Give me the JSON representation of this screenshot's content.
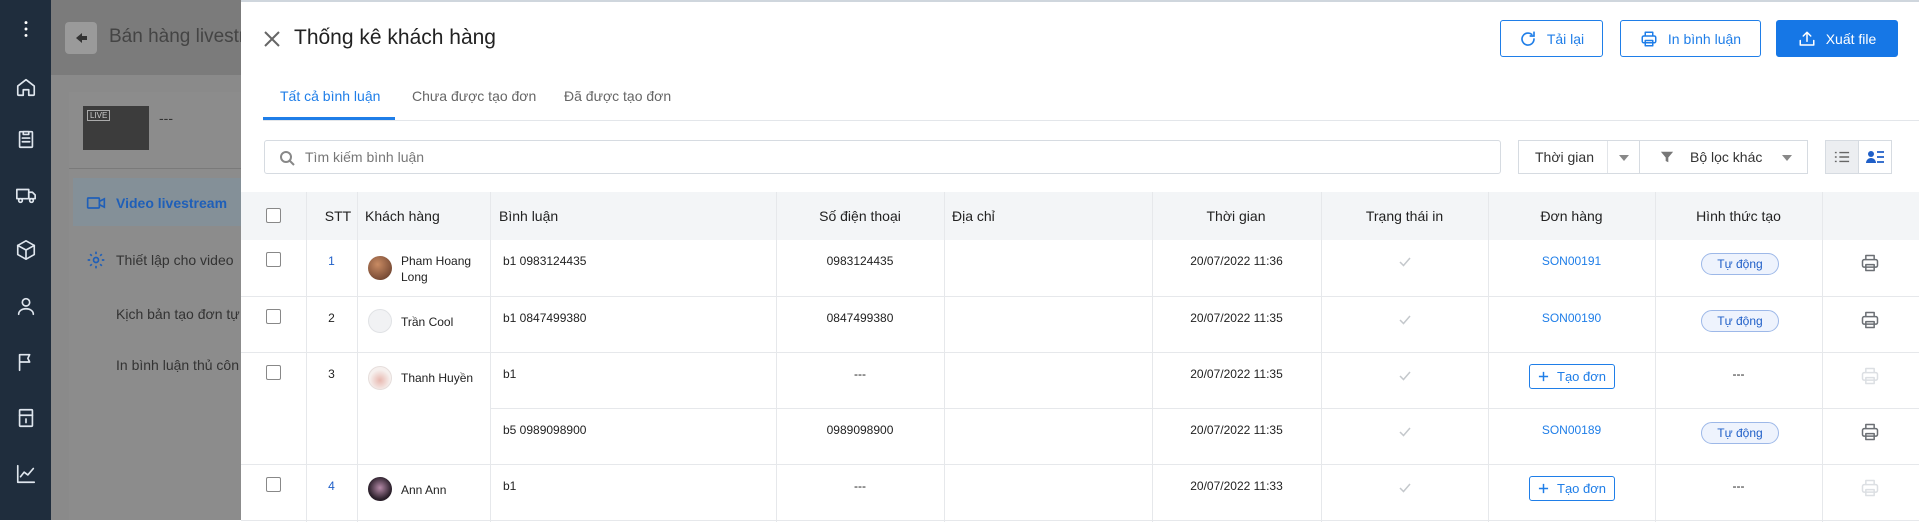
{
  "background": {
    "page_title": "Bán hàng livestre",
    "stream_title": "---",
    "live_badge": "LIVE",
    "menu": [
      {
        "label": "Video livestream",
        "active": true
      },
      {
        "label": "Thiết lập cho video"
      },
      {
        "label": "Kịch bản tạo đơn tự"
      },
      {
        "label": "In bình luận thủ côn"
      }
    ]
  },
  "modal": {
    "title": "Thống kê khách hàng",
    "buttons": {
      "reload": "Tải lại",
      "print": "In bình luận",
      "export": "Xuất file"
    },
    "tabs": [
      "Tất cả bình luận",
      "Chưa được tạo đơn",
      "Đã được tạo đơn"
    ],
    "active_tab": 0,
    "search_placeholder": "Tìm kiếm bình luận",
    "filters": {
      "time": "Thời gian",
      "other": "Bộ lọc khác"
    },
    "columns": [
      "STT",
      "Khách hàng",
      "Bình luận",
      "Số điện thoại",
      "Địa chỉ",
      "Thời gian",
      "Trạng thái in",
      "Đơn hàng",
      "Hình thức tạo"
    ],
    "create_order_label": "Tạo đơn",
    "rows": [
      {
        "stt": "1",
        "customer": [
          "Pham Hoang",
          "Long"
        ],
        "comment": "b1 0983124435",
        "phone": "0983124435",
        "address": "",
        "time": "20/07/2022 11:36",
        "order": "SON00191",
        "method": "Tự động",
        "print_enabled": true
      },
      {
        "stt": "2",
        "customer": [
          "Trần Cool"
        ],
        "comment": "b1 0847499380",
        "phone": "0847499380",
        "address": "",
        "time": "20/07/2022 11:35",
        "order": "SON00190",
        "method": "Tự động",
        "print_enabled": true
      },
      {
        "stt": "3",
        "customer": [
          "Thanh Huyền"
        ],
        "comment": "b1",
        "phone": "---",
        "address": "",
        "time": "20/07/2022 11:35",
        "order": null,
        "method": "---",
        "print_enabled": false
      },
      {
        "stt": "",
        "customer": [],
        "comment": "b5 0989098900",
        "phone": "0989098900",
        "address": "",
        "time": "20/07/2022 11:35",
        "order": "SON00189",
        "method": "Tự động",
        "print_enabled": true
      },
      {
        "stt": "4",
        "customer": [
          "Ann Ann"
        ],
        "comment": "b1",
        "phone": "---",
        "address": "",
        "time": "20/07/2022 11:33",
        "order": null,
        "method": "---",
        "print_enabled": false
      }
    ]
  },
  "colors": {
    "primary": "#1677e6",
    "rail": "#1f2d3d",
    "header_bg": "#f3f5f7",
    "badge_bg": "#eef3fd"
  },
  "icons": [
    "kebab-icon",
    "home-icon",
    "clipboard-icon",
    "truck-icon",
    "box-icon",
    "user-icon",
    "flag-icon",
    "wallet-icon",
    "chart-icon",
    "back-arrow-icon",
    "close-icon",
    "reload-icon",
    "printer-icon",
    "upload-icon",
    "search-icon",
    "filter-icon",
    "chevron-down-icon",
    "list-view-icon",
    "card-view-icon",
    "check-icon",
    "plus-icon"
  ]
}
